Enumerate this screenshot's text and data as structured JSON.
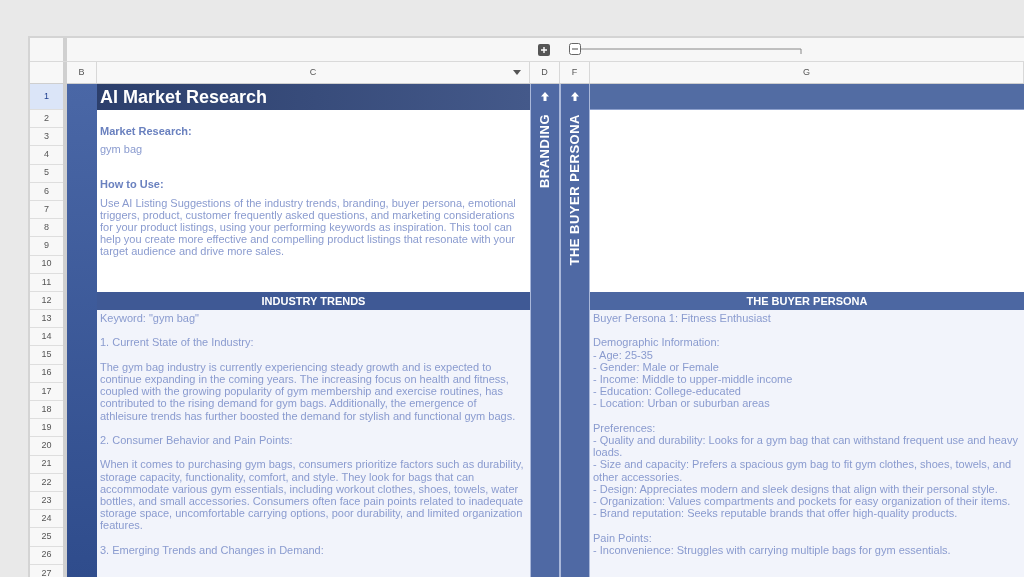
{
  "column_headers": [
    {
      "label": "B",
      "dropdown": false
    },
    {
      "label": "C",
      "dropdown": true
    },
    {
      "label": "D",
      "dropdown": false
    },
    {
      "label": "F",
      "dropdown": false
    },
    {
      "label": "G",
      "dropdown": false
    }
  ],
  "row_numbers": [
    {
      "label": "1",
      "selected": true
    },
    {
      "label": "2",
      "selected": false
    },
    {
      "label": "3",
      "selected": false
    },
    {
      "label": "4",
      "selected": false
    },
    {
      "label": "5",
      "selected": false
    },
    {
      "label": "6",
      "selected": false
    },
    {
      "label": "7",
      "selected": false
    },
    {
      "label": "8",
      "selected": false
    },
    {
      "label": "9",
      "selected": false
    },
    {
      "label": "10",
      "selected": false
    },
    {
      "label": "11",
      "selected": false
    },
    {
      "label": "12",
      "selected": false
    },
    {
      "label": "13",
      "selected": false
    },
    {
      "label": "14",
      "selected": false
    },
    {
      "label": "15",
      "selected": false
    },
    {
      "label": "16",
      "selected": false
    },
    {
      "label": "17",
      "selected": false
    },
    {
      "label": "18",
      "selected": false
    },
    {
      "label": "19",
      "selected": false
    },
    {
      "label": "20",
      "selected": false
    },
    {
      "label": "21",
      "selected": false
    },
    {
      "label": "22",
      "selected": false
    },
    {
      "label": "23",
      "selected": false
    },
    {
      "label": "24",
      "selected": false
    },
    {
      "label": "25",
      "selected": false
    },
    {
      "label": "26",
      "selected": false
    },
    {
      "label": "27",
      "selected": false
    }
  ],
  "title": "AI Market Research",
  "intro": {
    "market_research_label": "Market Research:",
    "market_research_value": "gym bag",
    "how_to_use_label": "How to Use:",
    "how_to_use_text": "Use AI Listing Suggestions of the industry trends, branding, buyer persona, emotional triggers, product, customer frequently asked questions, and marketing considerations for your product listings, using your performing keywords as inspiration. This tool can help you create more effective and compelling product listings that resonate with your target audience and drive more sales."
  },
  "vertical_labels": [
    "BRANDING",
    "THE BUYER PERSONA"
  ],
  "industry_trends": {
    "header": "INDUSTRY TRENDS",
    "paragraphs": [
      "Keyword: \"gym bag\"",
      "1. Current State of the Industry:",
      "The gym bag industry is currently experiencing steady growth and is expected to continue expanding in the coming years. The increasing focus on health and fitness, coupled with the growing popularity of gym membership and exercise routines, has contributed to the rising demand for gym bags. Additionally, the emergence of athleisure trends has further boosted the demand for stylish and functional gym bags.",
      "2. Consumer Behavior and Pain Points:",
      "When it comes to purchasing gym bags, consumers prioritize factors such as durability, storage capacity, functionality, comfort, and style. They look for bags that can accommodate various gym essentials, including workout clothes, shoes, towels, water bottles, and small accessories. Consumers often face pain points related to inadequate storage space, uncomfortable carrying options, poor durability, and limited organization features.",
      "3. Emerging Trends and Changes in Demand:"
    ]
  },
  "buyer_persona": {
    "header": "THE BUYER PERSONA",
    "groups": [
      {
        "lines": [
          "Buyer Persona 1: Fitness Enthusiast"
        ]
      },
      {
        "lines": [
          "Demographic Information:",
          "- Age: 25-35",
          "- Gender: Male or Female",
          "- Income: Middle to upper-middle income",
          "- Education: College-educated",
          "- Location: Urban or suburban areas"
        ]
      },
      {
        "lines": [
          "Preferences:",
          "- Quality and durability: Looks for a gym bag that can withstand frequent use and heavy loads.",
          "- Size and capacity: Prefers a spacious gym bag to fit gym clothes, shoes, towels, and other accessories.",
          "- Design: Appreciates modern and sleek designs that align with their personal style.",
          "- Organization: Values compartments and pockets for easy organization of their items.",
          "- Brand reputation: Seeks reputable brands that offer high-quality products."
        ]
      },
      {
        "lines": [
          "Pain Points:",
          "- Inconvenience: Struggles with carrying multiple bags for gym essentials."
        ]
      }
    ]
  }
}
